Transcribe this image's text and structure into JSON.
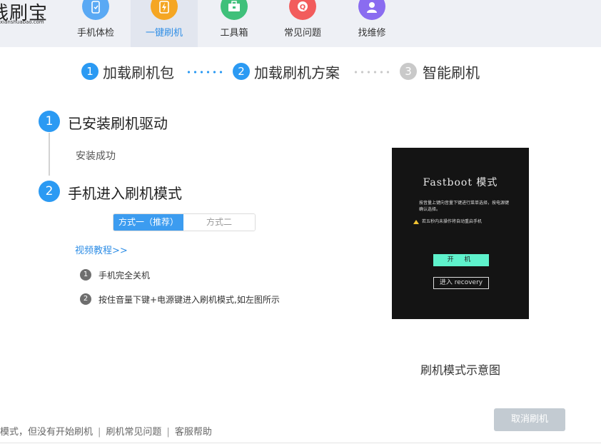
{
  "logo": {
    "main": "线刷宝",
    "sub": "xianshuabao.com"
  },
  "nav": [
    {
      "label": "手机体检",
      "icon": "phone-check-icon",
      "color": "#5aa9f4"
    },
    {
      "label": "一键刷机",
      "icon": "flash-icon",
      "color": "#f5a623",
      "active": true
    },
    {
      "label": "工具箱",
      "icon": "toolbox-icon",
      "color": "#3fc07a"
    },
    {
      "label": "常见问题",
      "icon": "question-icon",
      "color": "#f25c5c"
    },
    {
      "label": "找维修",
      "icon": "repair-icon",
      "color": "#8a6cf0"
    }
  ],
  "steps": [
    {
      "num": "1",
      "label": "加载刷机包"
    },
    {
      "num": "2",
      "label": "加载刷机方案"
    },
    {
      "num": "3",
      "label": "智能刷机"
    }
  ],
  "procedure": {
    "step1": {
      "num": "1",
      "title": "已安装刷机驱动",
      "status": "安装成功"
    },
    "step2": {
      "num": "2",
      "title": "手机进入刷机模式"
    },
    "methods": [
      "方式一（推荐）",
      "方式二"
    ],
    "video_link": "视频教程>>",
    "instructions": [
      {
        "num": "1",
        "text": "手机完全关机"
      },
      {
        "num": "2",
        "text": "按住音量下键+电源键进入刷机模式,如左图所示"
      }
    ]
  },
  "preview": {
    "title": "Fastboot 模式",
    "desc": "按音量上键向音量下键进行菜单选择，按电源键确认选择。",
    "warning": "若五秒内未操作将自动重启手机",
    "start_btn": "开 机",
    "recovery_btn": "进入 recovery",
    "caption": "刷机模式示意图"
  },
  "footer": {
    "text1": "模式，但没有开始刷机",
    "link1": "刷机常见问题",
    "link2": "客服帮助",
    "sep": "|"
  },
  "cancel_button": "取消刷机",
  "colors": {
    "accent": "#2b9af3",
    "inactive_step": "#c9c9c9",
    "link": "#2f8ee6"
  }
}
